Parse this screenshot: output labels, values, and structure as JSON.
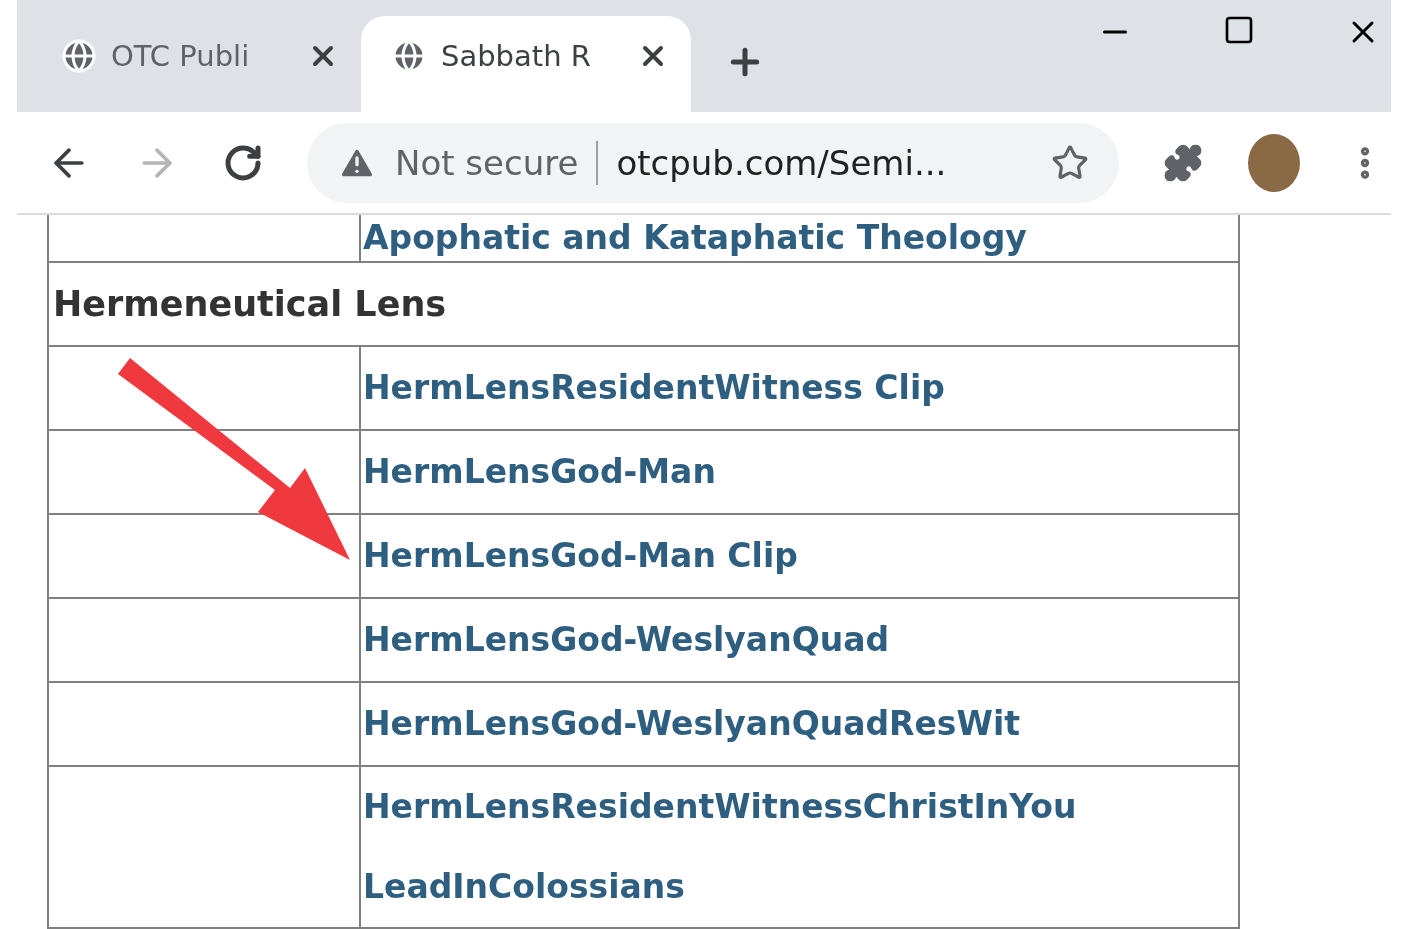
{
  "tabs": [
    {
      "title": "OTC Publi",
      "selected": false
    },
    {
      "title": "Sabbath R",
      "selected": true
    }
  ],
  "address_bar": {
    "security": "Not secure",
    "url": "otcpub.com/Semi..."
  },
  "table": {
    "rows": [
      {
        "kind": "link",
        "text": "Apophatic and Kataphatic Theology"
      },
      {
        "kind": "heading",
        "text": "Hermeneutical Lens"
      },
      {
        "kind": "link",
        "text": "HermLensResidentWitness Clip"
      },
      {
        "kind": "link",
        "text": "HermLensGod-Man"
      },
      {
        "kind": "link",
        "text": "HermLensGod-Man Clip"
      },
      {
        "kind": "link",
        "text": "HermLensGod-WeslyanQuad"
      },
      {
        "kind": "link",
        "text": "HermLensGod-WeslyanQuadResWit"
      },
      {
        "kind": "link",
        "text": "HermLensResidentWitnessChristInYou LeadInColossians"
      }
    ]
  }
}
